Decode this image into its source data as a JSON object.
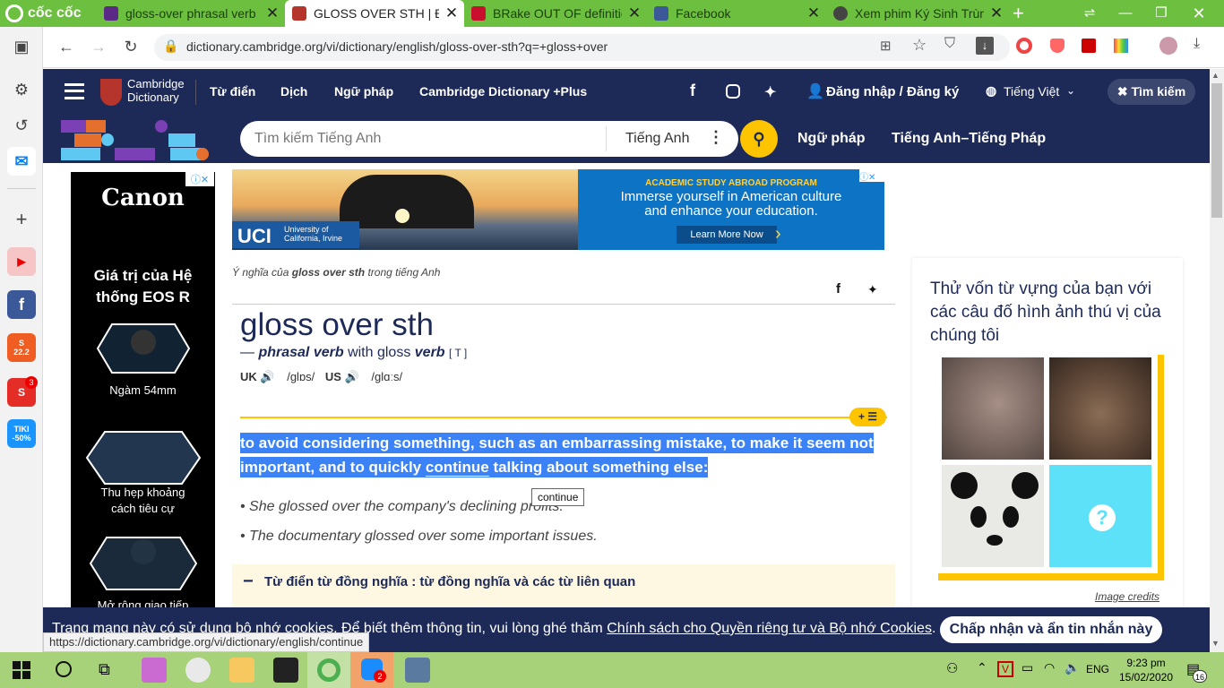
{
  "browser": {
    "brand": "cốc cốc",
    "tabs": [
      {
        "title": "gloss-over phrasal verb",
        "active": false
      },
      {
        "title": "GLOSS OVER STH | Định",
        "active": true
      },
      {
        "title": "BRake OUT OF definitio",
        "active": false
      },
      {
        "title": "Facebook",
        "active": false
      },
      {
        "title": "Xem phim Ký Sinh Trùng",
        "active": false
      }
    ],
    "new_tab": "+",
    "url": "dictionary.cambridge.org/vi/dictionary/english/gloss-over-sth?q=+gloss+over",
    "status_url": "https://dictionary.cambridge.org/vi/dictionary/english/continue"
  },
  "sidebar": {
    "badges": {
      "mail_count": "3",
      "tiki": "TIKI",
      "tiki_sale": "-50%",
      "shopee": "22.2"
    }
  },
  "header": {
    "logo_line1": "Cambridge",
    "logo_line2": "Dictionary",
    "nav": [
      "Từ điển",
      "Dịch",
      "Ngữ pháp",
      "Cambridge Dictionary +Plus"
    ],
    "login": "Đăng nhập / Đăng ký",
    "language": "Tiếng Việt",
    "search_toggle": "Tìm kiếm",
    "search_placeholder": "Tìm kiếm Tiếng Anh",
    "search_lang": "Tiếng Anh",
    "grammar_link": "Ngữ pháp",
    "bilingual_link": "Tiếng Anh–Tiếng Pháp"
  },
  "canon_ad": {
    "brand": "Canon",
    "headline": "Giá trị của Hệ thống EOS R",
    "item1": "Ngàm 54mm",
    "item2": "Thu hẹp khoảng cách tiêu cự",
    "item3": "Mở rộng giao tiếp"
  },
  "uci_ad": {
    "brand": "UCI",
    "brand_sub1": "University of",
    "brand_sub2": "California, Irvine",
    "tagline": "ACADEMIC STUDY ABROAD PROGRAM",
    "body": "Immerse yourself in American culture and enhance your education.",
    "cta": "Learn More Now"
  },
  "entry": {
    "meaning_prefix": "Ý nghĩa của",
    "meaning_word": "gloss over sth",
    "meaning_suffix": "trong tiếng Anh",
    "headword": "gloss over sth",
    "dash": "—",
    "pos": "phrasal verb",
    "with_text": "with gloss",
    "with_pos": "verb",
    "grammar": "[ T ]",
    "uk_label": "UK",
    "uk_ipa": "/ɡlɒs/",
    "us_label": "US",
    "us_ipa": "/ɡlɑːs/",
    "add_button": "+",
    "definition_before": "to avoid considering something, such as an embarrassing mistake, to make it seem not important, and to quickly",
    "definition_link": "continue",
    "definition_after": "talking about something else:",
    "tooltip": "continue",
    "examples": [
      "She glossed over the company's declining profits.",
      "The documentary glossed over some important issues."
    ],
    "thesaurus": "Từ điển từ đồng nghĩa : từ đồng nghĩa và các từ liên quan"
  },
  "quiz": {
    "title": "Thử vốn từ vựng của bạn với các câu đố hình ảnh thú vị của chúng tôi",
    "unknown": "?",
    "credits": "Image credits"
  },
  "cookie": {
    "text_before": "Trang mạng này có sử dụng bộ nhớ cookies. Để biết thêm thông tin, vui lòng ghé thăm",
    "link": "Chính sách cho Quyền riêng tư và Bộ nhớ Cookies",
    "text_after": ".",
    "accept": "Chấp nhận và ẩn tin nhắn này"
  },
  "taskbar": {
    "lang": "ENG",
    "time": "9:23 pm",
    "date": "15/02/2020",
    "notif_count": "16",
    "zalo_badge": "2"
  },
  "colors": {
    "browser_green": "#6cbf3f",
    "cambridge_navy": "#1d2a57",
    "accent_yellow": "#fec400",
    "highlight": "#3b82f6"
  }
}
